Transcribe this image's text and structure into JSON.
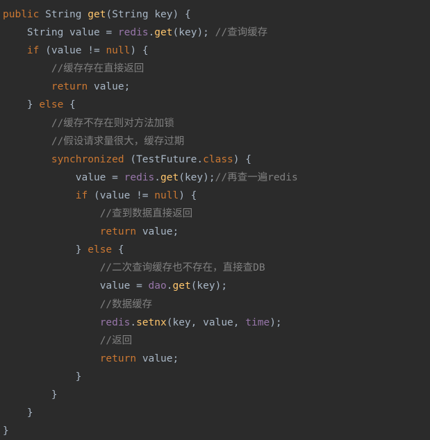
{
  "code": {
    "line1": {
      "public": "public",
      "stringType": "String",
      "methodName": "get",
      "paramType": "String",
      "paramName": "key"
    },
    "line2": {
      "stringType": "String",
      "varName": "value",
      "field": "redis",
      "method": "get",
      "arg": "key",
      "comment": "//查询缓存"
    },
    "line3": {
      "ifKw": "if",
      "cond": "value != ",
      "nullKw": "null"
    },
    "line4": {
      "comment": "//缓存存在直接返回"
    },
    "line5": {
      "returnKw": "return",
      "val": "value"
    },
    "line6": {
      "elseKw": "else"
    },
    "line7": {
      "comment": "//缓存不存在则对方法加锁"
    },
    "line8": {
      "comment": "//假设请求量很大，缓存过期"
    },
    "line9": {
      "syncKw": "synchronized",
      "className": "TestFuture",
      "classKw": "class"
    },
    "line10": {
      "varName": "value",
      "field": "redis",
      "method": "get",
      "arg": "key",
      "comment": "//再查一遍redis"
    },
    "line11": {
      "ifKw": "if",
      "cond": "value != ",
      "nullKw": "null"
    },
    "line12": {
      "comment": "//查到数据直接返回"
    },
    "line13": {
      "returnKw": "return",
      "val": "value"
    },
    "line14": {
      "elseKw": "else"
    },
    "line15": {
      "comment": "//二次查询缓存也不存在，直接查DB"
    },
    "line16": {
      "varName": "value",
      "field": "dao",
      "method": "get",
      "arg": "key"
    },
    "line17": {
      "comment": "//数据缓存"
    },
    "line18": {
      "field": "redis",
      "method": "setnx",
      "arg1": "key",
      "arg2": "value",
      "arg3": "time"
    },
    "line19": {
      "comment": "//返回"
    },
    "line20": {
      "returnKw": "return",
      "val": "value"
    }
  }
}
